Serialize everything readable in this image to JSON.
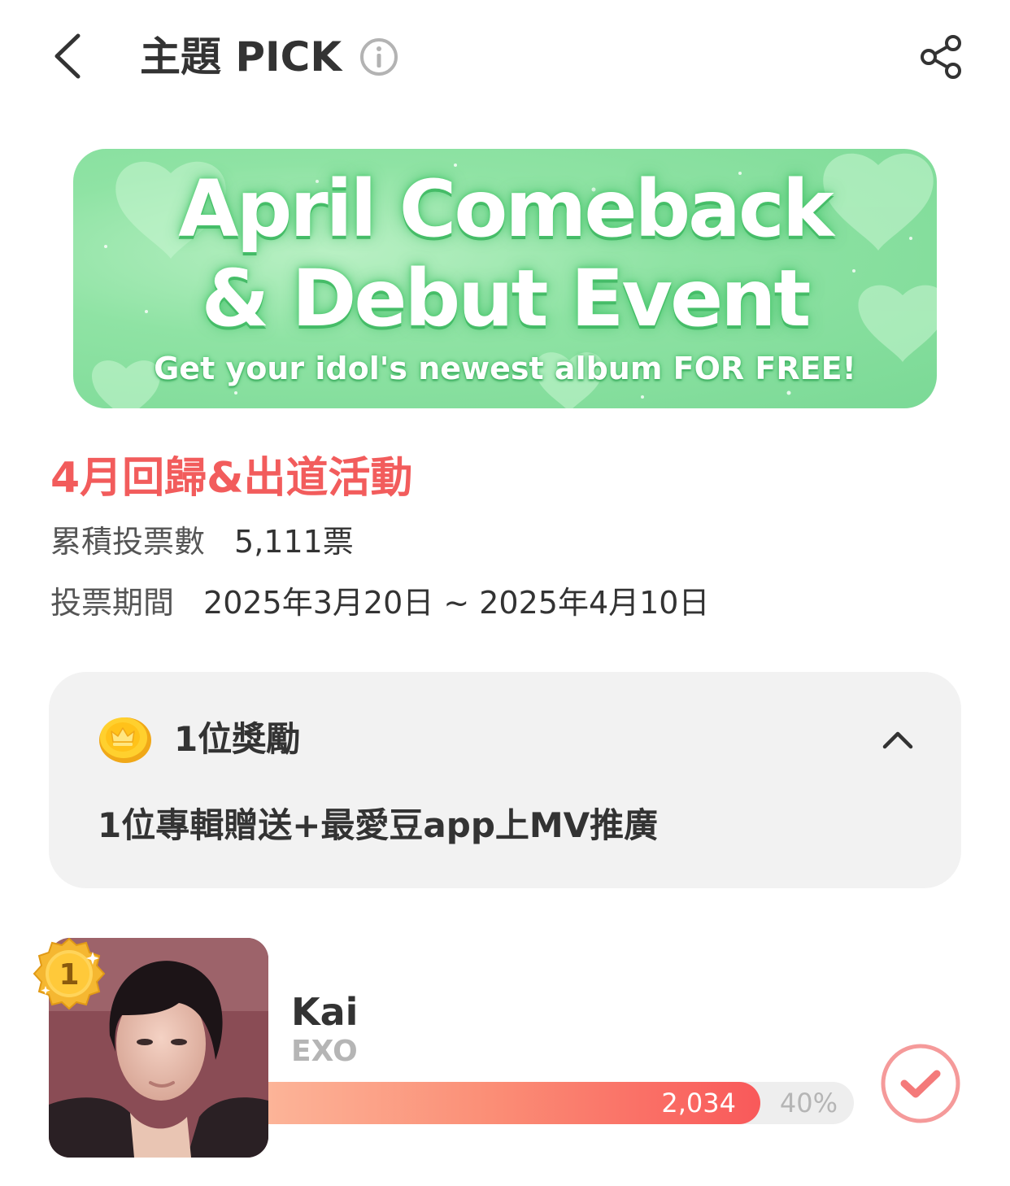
{
  "header": {
    "title": "主題 PICK",
    "icons": {
      "back": "chevron-left-icon",
      "info": "info-circle-icon",
      "share": "share-icon"
    }
  },
  "banner": {
    "line1": "April Comeback",
    "line2": "& Debut Event",
    "subtitle": "Get your idol's newest album FOR FREE!"
  },
  "event": {
    "title": "4月回歸&出道活動",
    "votes_label": "累積投票數",
    "votes_value": "5,111票",
    "period_label": "投票期間",
    "period_value": "2025年3月20日 ~ 2025年4月10日"
  },
  "reward": {
    "title": "1位獎勵",
    "description": "1位專輯贈送+最愛豆app上MV推廣",
    "icons": {
      "coin": "crown-coin-icon",
      "toggle": "chevron-up-icon"
    }
  },
  "candidates": [
    {
      "rank": "1",
      "name": "Kai",
      "group": "EXO",
      "votes": "2,034",
      "percent": "40%",
      "share": 0.4
    }
  ],
  "colors": {
    "accent": "#f25c5c",
    "banner_green": "#8fe3a4",
    "card_bg": "#f2f2f2",
    "bar_start": "#fcb498",
    "bar_end": "#f9595a",
    "vote_ring": "#f59a9a"
  }
}
